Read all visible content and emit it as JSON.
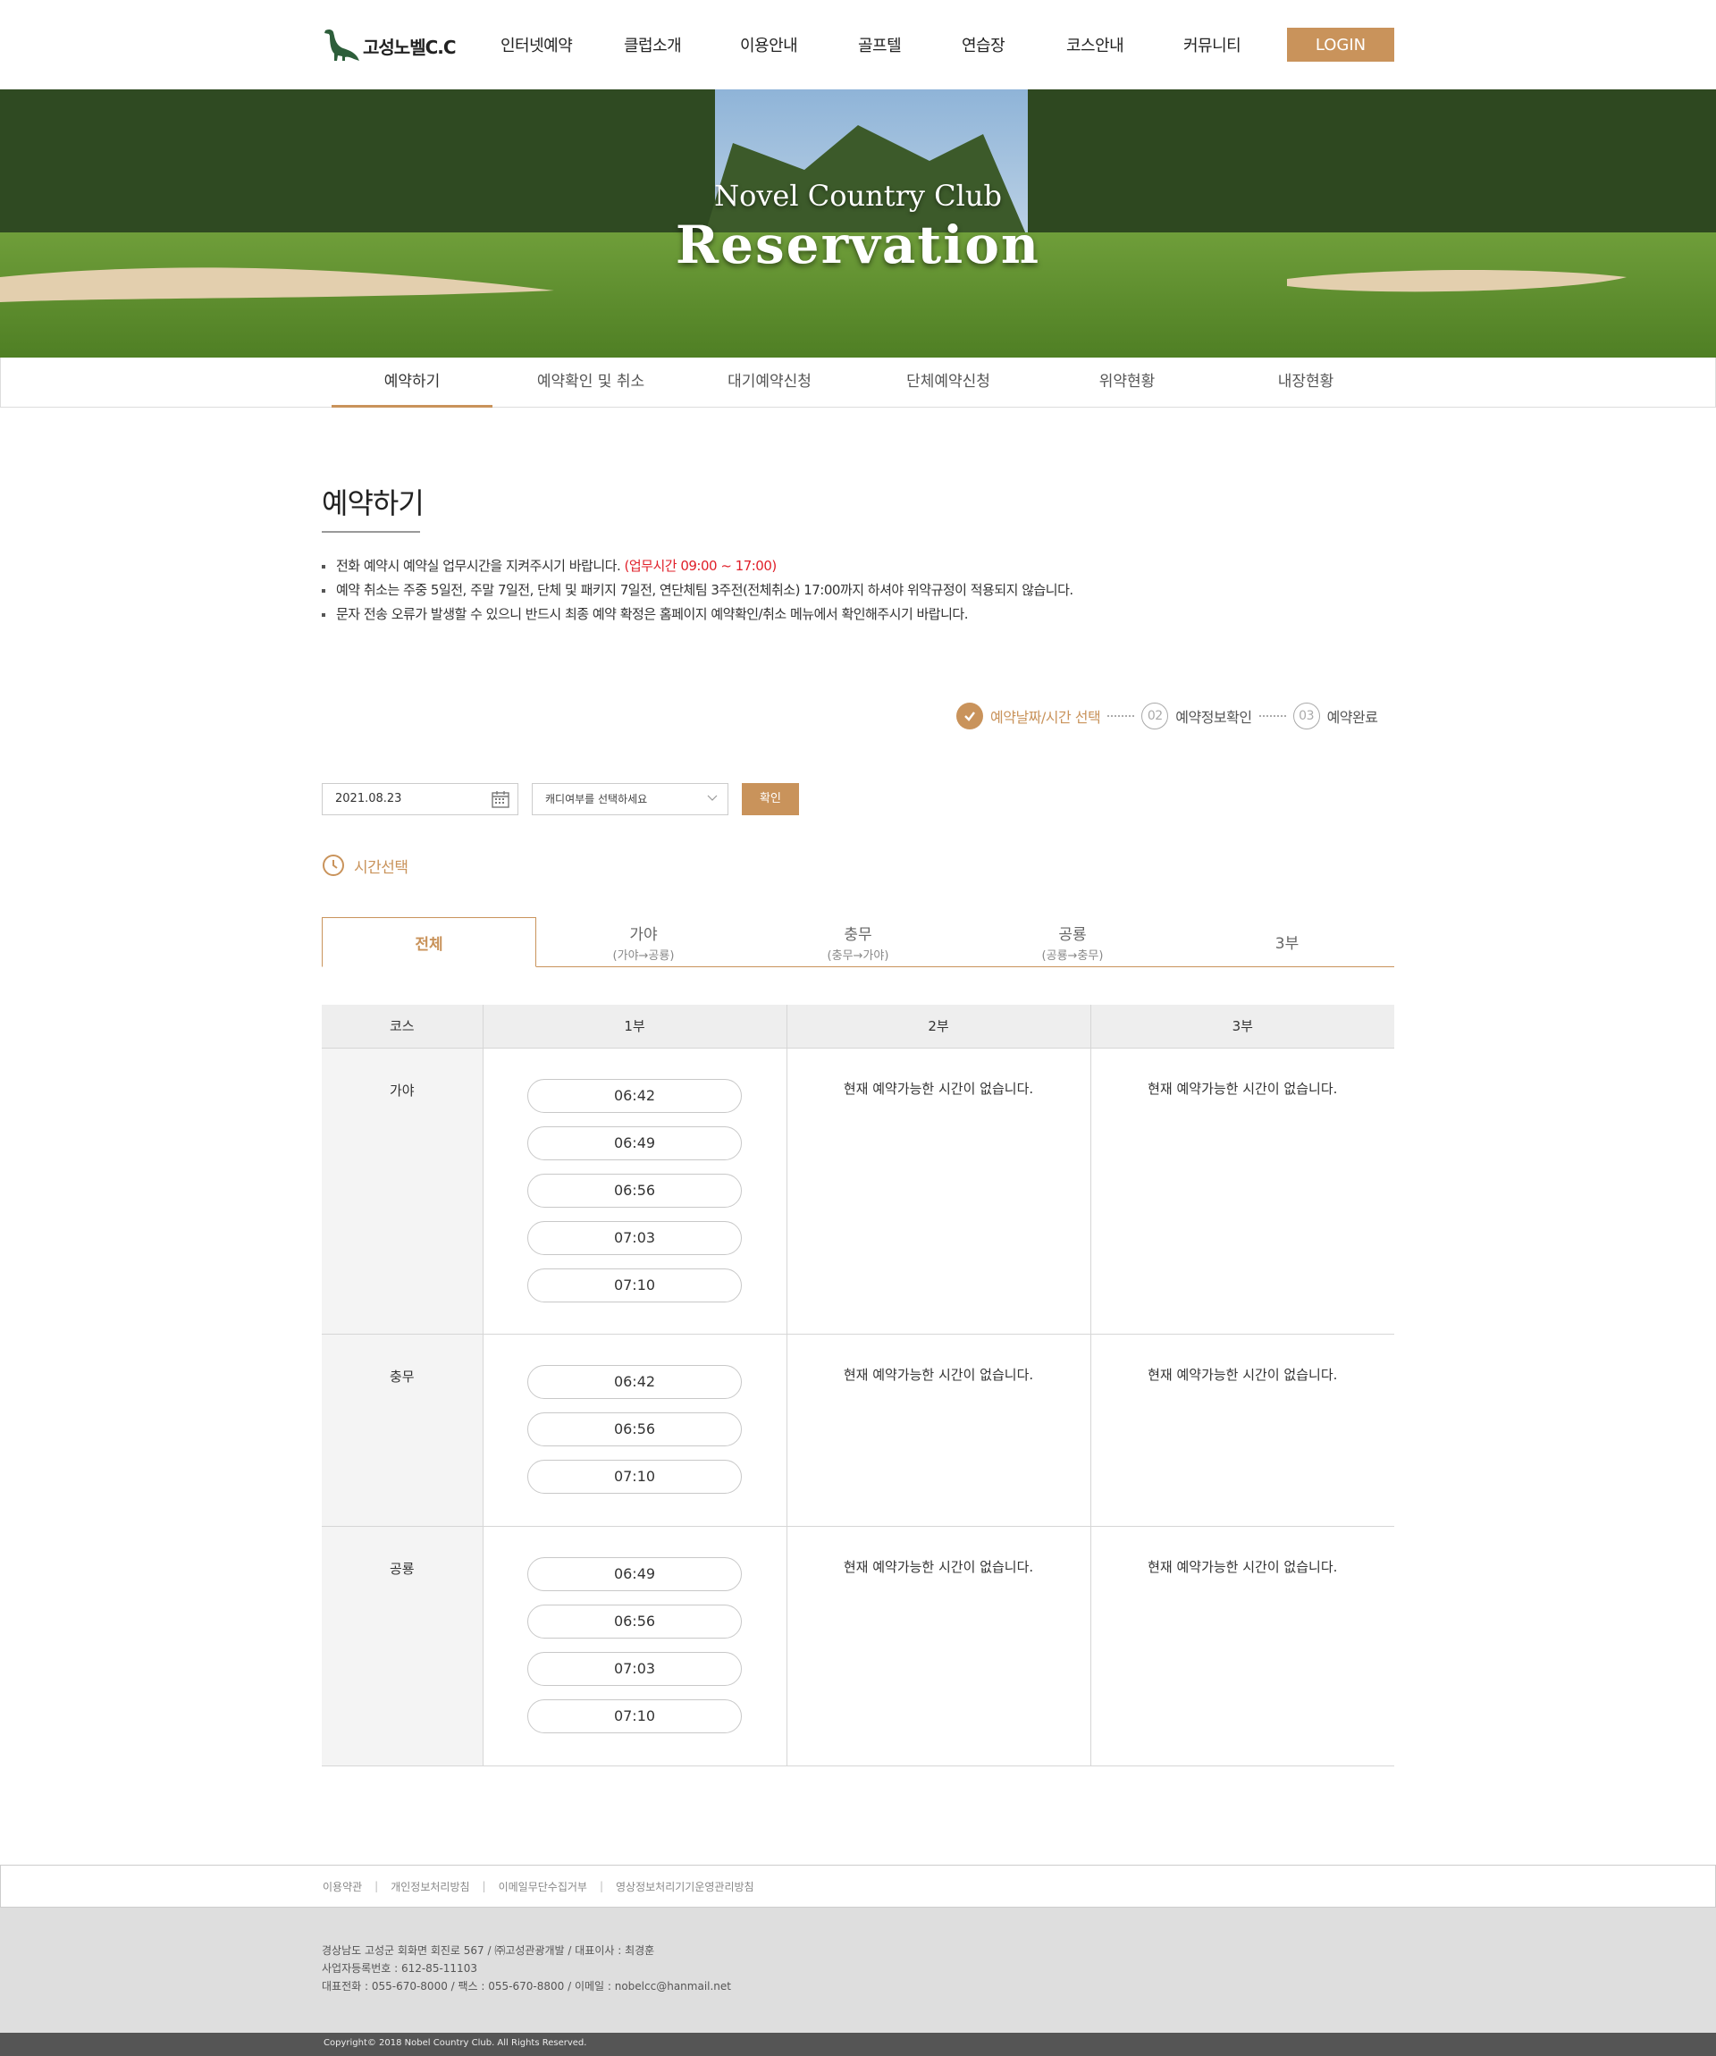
{
  "logo": {
    "text": "고성노벨C.C"
  },
  "gnb": [
    "인터넷예약",
    "클럽소개",
    "이용안내",
    "골프텔",
    "연습장",
    "코스안내",
    "커뮤니티"
  ],
  "login_label": "LOGIN",
  "hero": {
    "subtitle": "Novel Country Club",
    "title": "Reservation"
  },
  "subnav": [
    "예약하기",
    "예약확인 및 취소",
    "대기예약신청",
    "단체예약신청",
    "위약현황",
    "내장현황"
  ],
  "page_title": "예약하기",
  "notices": {
    "n1": "전화 예약시 예약실 업무시간을 지켜주시기 바랍니다.",
    "n1_red": "(업무시간 09:00 ~ 17:00)",
    "n2": "예약 취소는 주중 5일전, 주말 7일전, 단체 및 패키지 7일전, 연단체팀 3주전(전체취소) 17:00까지 하셔야 위약규정이 적용되지 않습니다.",
    "n3": "문자 전송 오류가 발생할 수 있으니 반드시 최종 예약 확정은 홈페이지 예약확인/취소 메뉴에서 확인해주시기 바랍니다."
  },
  "steps": {
    "s1": "예약날짜/시간 선택",
    "s2_num": "02",
    "s2": "예약정보확인",
    "s3_num": "03",
    "s3": "예약완료"
  },
  "form": {
    "date": "2021.08.23",
    "caddy_placeholder": "캐디여부를 선택하세요",
    "confirm": "확인"
  },
  "time_select_label": "시간선택",
  "tabs": [
    {
      "label": "전체",
      "sub": ""
    },
    {
      "label": "가야",
      "sub": "(가야→공룡)"
    },
    {
      "label": "충무",
      "sub": "(충무→가야)"
    },
    {
      "label": "공룡",
      "sub": "(공룡→충무)"
    },
    {
      "label": "3부",
      "sub": ""
    }
  ],
  "table": {
    "headers": [
      "코스",
      "1부",
      "2부",
      "3부"
    ],
    "none_message": "현재 예약가능한 시간이 없습니다.",
    "rows": [
      {
        "course": "가야",
        "p1": [
          "06:42",
          "06:49",
          "06:56",
          "07:03",
          "07:10"
        ]
      },
      {
        "course": "충무",
        "p1": [
          "06:42",
          "06:56",
          "07:10"
        ]
      },
      {
        "course": "공룡",
        "p1": [
          "06:49",
          "06:56",
          "07:03",
          "07:10"
        ]
      }
    ]
  },
  "footer": {
    "links": [
      "이용약관",
      "개인정보처리방침",
      "이메일무단수집거부",
      "영상정보처리기기운영관리방침"
    ],
    "address": "경상남도 고성군 회화면 회진로 567 / ㈜고성관광개발 / 대표이사 : 최경훈",
    "biz_no": "사업자등록번호 : 612-85-11103",
    "contact": "대표전화 : 055-670-8000 / 팩스 : 055-670-8800 / 이메일 : nobelcc@hanmail.net",
    "copyright": "Copyright© 2018 Nobel Country Club. All Rights Reserved."
  },
  "colors": {
    "accent": "#c9935b",
    "notice_red": "#e0202a",
    "table_header": "#eeeeee",
    "footer_bg": "#dedede",
    "copyright_bg": "#555555"
  }
}
